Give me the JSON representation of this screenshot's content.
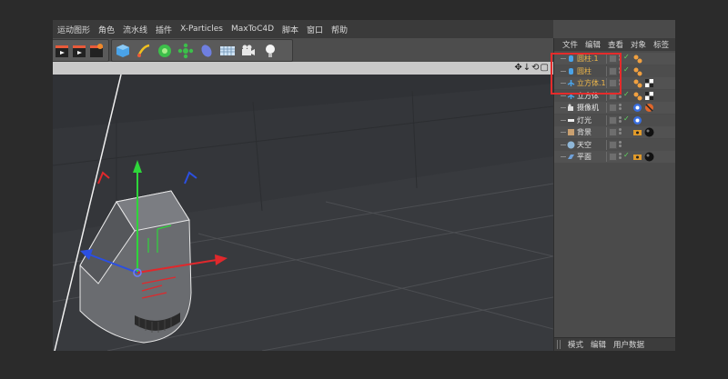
{
  "menubar": {
    "items": [
      "运动图形",
      "角色",
      "流水线",
      "插件",
      "X-Particles",
      "MaxToC4D",
      "脚本",
      "窗口",
      "帮助"
    ]
  },
  "toolbar": {
    "icons": [
      "clapper-icon",
      "clapper-icon",
      "clapper-icon",
      "cube-icon",
      "pen-icon",
      "subdivision-icon",
      "cloner-icon",
      "deformer-icon",
      "floor-grid-icon",
      "camera-icon",
      "light-bulb-icon"
    ]
  },
  "viewport": {
    "nav_icons": "✥↓⟲▢"
  },
  "object_manager": {
    "tabs": [
      "文件",
      "编辑",
      "查看",
      "对象",
      "标签"
    ],
    "objects": [
      {
        "label": "圆柱.1",
        "color": "#f0b84a",
        "icon": "cylinder-icon",
        "selected": true,
        "checked": true,
        "tags": [
          "phong-tag"
        ]
      },
      {
        "label": "圆柱",
        "color": "#f0b84a",
        "icon": "cylinder-icon",
        "selected": true,
        "checked": true,
        "tags": [
          "phong-tag"
        ]
      },
      {
        "label": "立方体.1",
        "color": "#f0b84a",
        "icon": "null-icon",
        "selected": true,
        "checked": false,
        "tags": [
          "phong-tag",
          "checker-tag"
        ]
      },
      {
        "label": "立方体",
        "color": "#e8e8e8",
        "icon": "null-icon",
        "selected": false,
        "checked": true,
        "tags": [
          "phong-tag",
          "checker-tag"
        ]
      },
      {
        "label": "摄像机",
        "color": "#e8e8e8",
        "icon": "camera-icon",
        "selected": false,
        "checked": false,
        "tags": [
          "target-tag",
          "protection-tag"
        ]
      },
      {
        "label": "灯光",
        "color": "#e8e8e8",
        "icon": "light-icon",
        "selected": false,
        "checked": true,
        "tags": [
          "target-tag"
        ]
      },
      {
        "label": "背景",
        "color": "#e8e8e8",
        "icon": "background-icon",
        "selected": false,
        "checked": false,
        "tags": [
          "compositing-tag",
          "material-tag"
        ]
      },
      {
        "label": "天空",
        "color": "#e8e8e8",
        "icon": "sky-icon",
        "selected": false,
        "checked": false,
        "tags": []
      },
      {
        "label": "平面",
        "color": "#e8e8e8",
        "icon": "plane-icon",
        "selected": false,
        "checked": true,
        "tags": [
          "compositing-tag",
          "material-tag"
        ]
      }
    ]
  },
  "attribute_manager": {
    "tabs": [
      "模式",
      "编辑",
      "用户数据"
    ]
  },
  "colors": {
    "selection_highlight": "#e52b2b",
    "axis_y": "#2ed63a",
    "axis_x": "#e0282c",
    "axis_z": "#2b4fe0"
  }
}
